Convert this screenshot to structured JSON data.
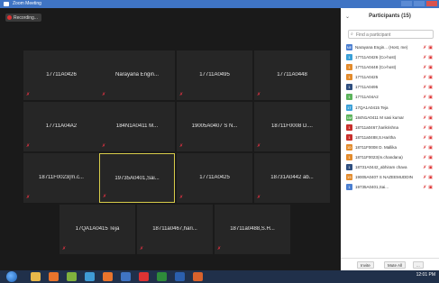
{
  "window": {
    "title": "Zoom Meeting"
  },
  "recording": {
    "label": "Recording..."
  },
  "tiles": [
    {
      "name": "17711A0426"
    },
    {
      "name": "Narayana Engin..."
    },
    {
      "name": "17711A0495"
    },
    {
      "name": "17711A0448"
    },
    {
      "name": "17711A04A2"
    },
    {
      "name": "184N1A0411 M..."
    },
    {
      "name": "19005A0407 S N..."
    },
    {
      "name": "18711F0008 D...."
    },
    {
      "name": "18711F0023(m.c..."
    },
    {
      "name": "19735A0401,Sai..."
    },
    {
      "name": "17711A0425"
    },
    {
      "name": "18731A0442 ab..."
    },
    {
      "name": "17QA1A0415 Teja"
    },
    {
      "name": "18711a0467,hari..."
    },
    {
      "name": "18711a0488,S.H..."
    }
  ],
  "panel": {
    "title": "Participants (15)",
    "search_placeholder": "Find a participant",
    "participants": [
      {
        "initials": "NE",
        "name": "Narayana Engin...  (Host, me)",
        "color": "#4b7fd1"
      },
      {
        "initials": "1",
        "name": "17711A0426 (Co-host)",
        "color": "#3aa0d8"
      },
      {
        "initials": "1",
        "name": "17711A0448 (Co-host)",
        "color": "#e38b2c"
      },
      {
        "initials": "1",
        "name": "17711A0425",
        "color": "#e38b2c"
      },
      {
        "initials": "1",
        "name": "17711A0495",
        "color": "#2f4f7f"
      },
      {
        "initials": "1",
        "name": "17711A04A2",
        "color": "#5bb35b"
      },
      {
        "initials": "1T",
        "name": "17QA1A0415 Teja",
        "color": "#3aa0d8"
      },
      {
        "initials": "1M",
        "name": "184N1A0411 M sasi kumar",
        "color": "#5bb35b"
      },
      {
        "initials": "1",
        "name": "18711a0467,harikrishna",
        "color": "#c9302c"
      },
      {
        "initials": "1",
        "name": "18711a0488,S.Haritha",
        "color": "#c9302c"
      },
      {
        "initials": "1D",
        "name": "18711F0008 D. Mallika",
        "color": "#e38b2c"
      },
      {
        "initials": "1",
        "name": "18711F0023(m.chandana)",
        "color": "#e38b2c"
      },
      {
        "initials": "1",
        "name": "18731A0442_abhiram chava",
        "color": "#2f4f7f"
      },
      {
        "initials": "1S",
        "name": "19005A0407 S NAZEEMUDDIN",
        "color": "#e38b2c"
      },
      {
        "initials": "1",
        "name": "19735A0401,Sai...",
        "color": "#4b7fd1"
      }
    ],
    "invite_label": "Invite",
    "mute_all_label": "Mute All",
    "more_label": "..."
  },
  "taskbar": {
    "apps": [
      {
        "icon": "explorer-icon",
        "color": "#e8b84a"
      },
      {
        "icon": "firefox-icon",
        "color": "#e8742c"
      },
      {
        "icon": "app-icon",
        "color": "#7fb13d"
      },
      {
        "icon": "chrome-icon",
        "color": "#3f9bd6"
      },
      {
        "icon": "vlc-icon",
        "color": "#e8742c"
      },
      {
        "icon": "zoom-icon",
        "color": "#3f74c4"
      },
      {
        "icon": "media-icon",
        "color": "#d33"
      },
      {
        "icon": "excel-icon",
        "color": "#2e8b3a"
      },
      {
        "icon": "word-icon",
        "color": "#2b5fad"
      },
      {
        "icon": "ppt-icon",
        "color": "#d8622c"
      }
    ],
    "clock": "12:01 PM"
  }
}
